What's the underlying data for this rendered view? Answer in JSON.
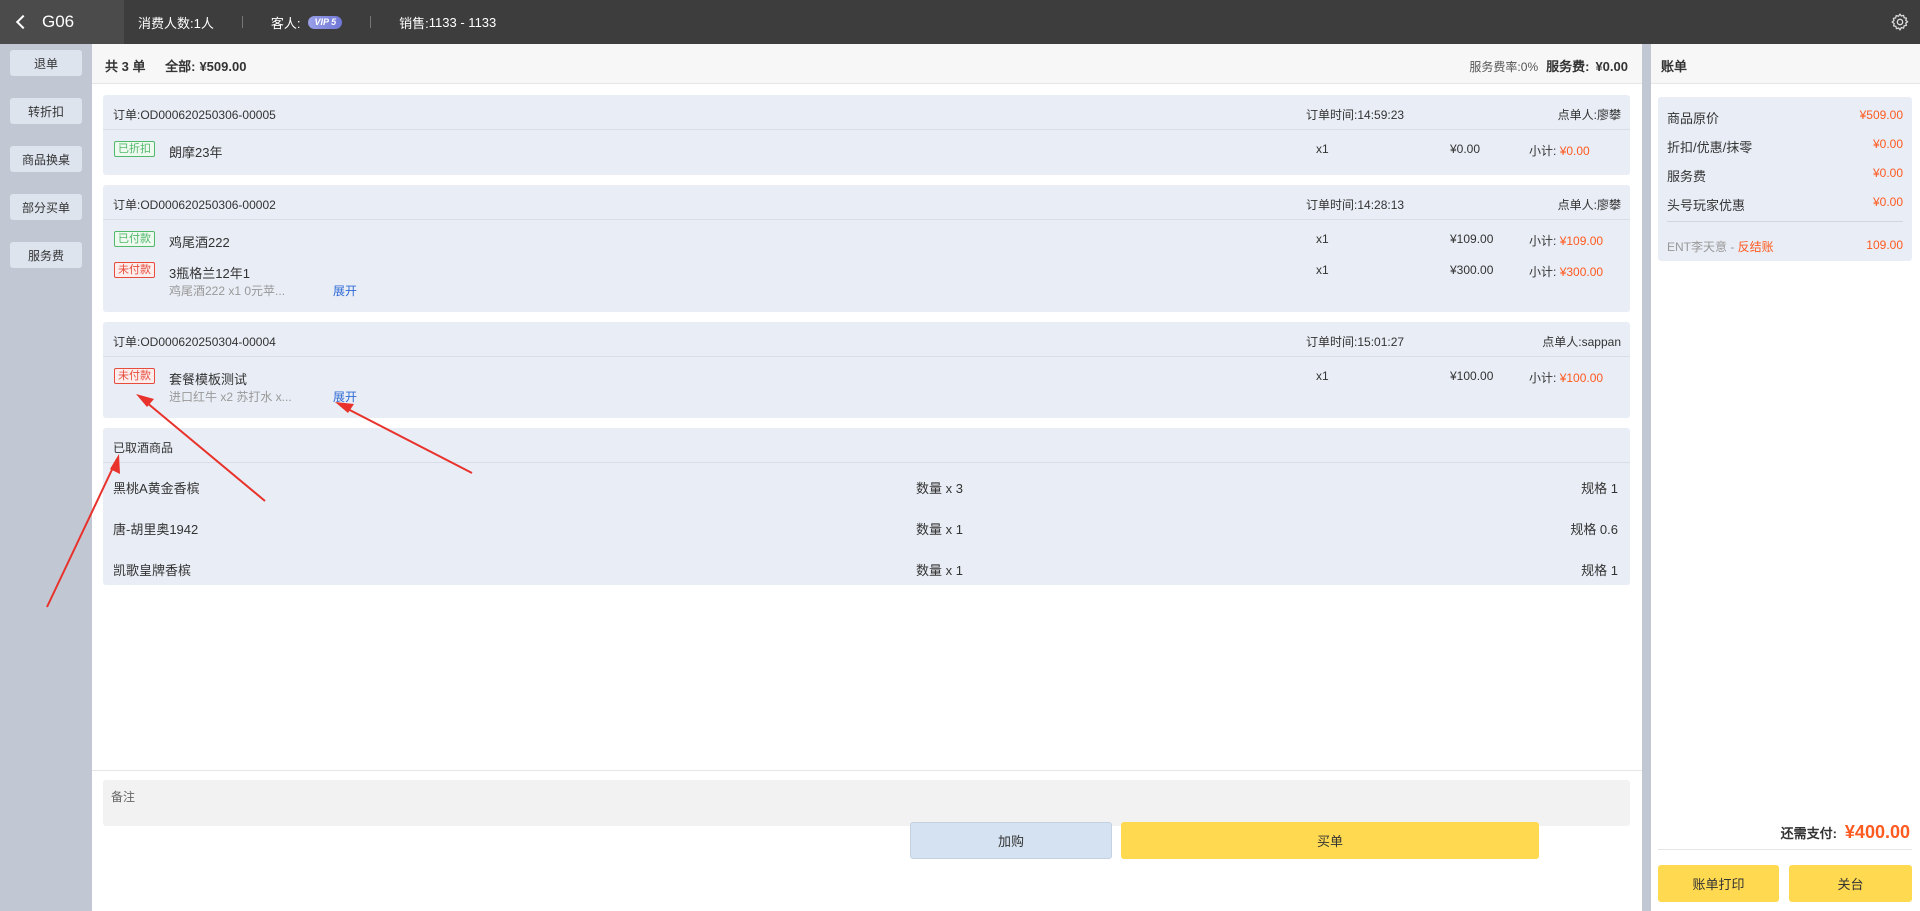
{
  "topbar": {
    "table_name": "G06",
    "guests_label": "消费人数:",
    "guests_value": "1人",
    "customer_label": "客人:",
    "vip_badge": "VIP 5",
    "sales_label": "销售:",
    "sales_value": "1133 - 1133"
  },
  "sidebar": {
    "buttons": [
      "退单",
      "转折扣",
      "商品换桌",
      "部分买单",
      "服务费"
    ]
  },
  "summary": {
    "count": "共 3 单",
    "total_label": "全部:",
    "total_value": "¥509.00",
    "rate_label": "服务费率:",
    "rate_value": "0%",
    "fee_label": "服务费:",
    "fee_value": "¥0.00"
  },
  "orders": [
    {
      "no_label": "订单:",
      "no": "OD000620250306-00005",
      "time_label": "订单时间:",
      "time": "14:59:23",
      "who_label": "点单人:",
      "who": "廖攀",
      "items": [
        {
          "badge": "已折扣",
          "name": "朗摩23年",
          "qty": "x1",
          "price": "¥0.00",
          "sub_label": "小计:",
          "sub": "¥0.00"
        }
      ]
    },
    {
      "no_label": "订单:",
      "no": "OD000620250306-00002",
      "time_label": "订单时间:",
      "time": "14:28:13",
      "who_label": "点单人:",
      "who": "廖攀",
      "items": [
        {
          "badge": "已付款",
          "name": "鸡尾酒222",
          "qty": "x1",
          "price": "¥109.00",
          "sub_label": "小计:",
          "sub": "¥109.00"
        },
        {
          "badge": "未付款",
          "name": "3瓶格兰12年1",
          "qty": "x1",
          "price": "¥300.00",
          "sub_label": "小计:",
          "sub": "¥300.00",
          "detail": "鸡尾酒222 x1   0元苹...",
          "expand": "展开"
        }
      ]
    },
    {
      "no_label": "订单:",
      "no": "OD000620250304-00004",
      "time_label": "订单时间:",
      "time": "15:01:27",
      "who_label": "点单人:",
      "who": "sappan",
      "items": [
        {
          "badge": "未付款",
          "name": "套餐模板测试",
          "qty": "x1",
          "price": "¥100.00",
          "sub_label": "小计:",
          "sub": "¥100.00",
          "detail": "进口红牛 x2   苏打水 x...",
          "expand": "展开"
        }
      ]
    }
  ],
  "taken": {
    "title": "已取酒商品",
    "rows": [
      {
        "name": "黑桃A黄金香槟",
        "qty": "数量 x 3",
        "spec": "规格 1"
      },
      {
        "name": "唐-胡里奥1942",
        "qty": "数量 x 1",
        "spec": "规格 0.6"
      },
      {
        "name": "凯歌皇牌香槟",
        "qty": "数量 x 1",
        "spec": "规格 1"
      }
    ]
  },
  "note": {
    "label": "备注"
  },
  "actions": {
    "add": "加购",
    "pay": "买单"
  },
  "bill": {
    "title": "账单",
    "rows": [
      {
        "label": "商品原价",
        "value": "¥509.00"
      },
      {
        "label": "折扣/优惠/抹零",
        "value": "¥0.00"
      },
      {
        "label": "服务费",
        "value": "¥0.00"
      },
      {
        "label": "头号玩家优惠",
        "value": "¥0.00"
      }
    ],
    "ent_label": "ENT李天意 - ",
    "ent_link": "反结账",
    "ent_value": "109.00",
    "due_label": "还需支付:",
    "due_value": "¥400.00",
    "print": "账单打印",
    "close": "关台"
  },
  "colors": {
    "accent": "#ff5a1f",
    "button_yellow": "#ffd94f",
    "panel_bg": "#e9edf5",
    "annotation_arrow": "#e8322b"
  }
}
